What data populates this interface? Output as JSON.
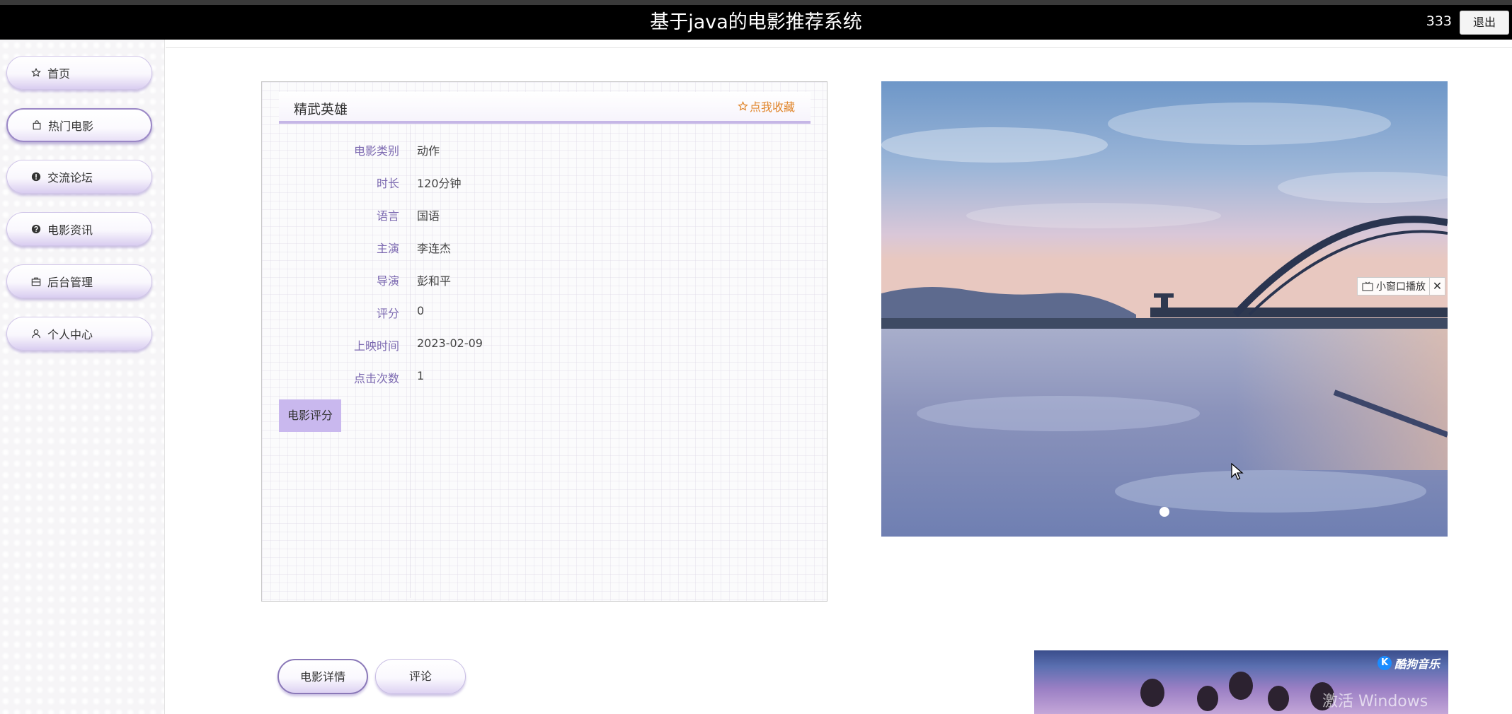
{
  "header": {
    "title": "基于java的电影推荐系统",
    "username": "333",
    "logout_label": "退出"
  },
  "sidebar": {
    "items": [
      {
        "label": "首页",
        "icon": "star-outline-icon"
      },
      {
        "label": "热门电影",
        "icon": "bag-icon",
        "active": true
      },
      {
        "label": "交流论坛",
        "icon": "exclamation-circle-icon"
      },
      {
        "label": "电影资讯",
        "icon": "question-circle-icon"
      },
      {
        "label": "后台管理",
        "icon": "briefcase-icon"
      },
      {
        "label": "个人中心",
        "icon": "user-icon"
      }
    ]
  },
  "movie": {
    "name": "精武英雄",
    "favorite_label": "点我收藏",
    "fields": [
      {
        "label": "电影类别",
        "value": "动作"
      },
      {
        "label": "时长",
        "value": "120分钟"
      },
      {
        "label": "语言",
        "value": "国语"
      },
      {
        "label": "主演",
        "value": "李连杰"
      },
      {
        "label": "导演",
        "value": "彭和平"
      },
      {
        "label": "评分",
        "value": "0"
      },
      {
        "label": "上映时间",
        "value": "2023-02-09"
      },
      {
        "label": "点击次数",
        "value": "1"
      }
    ],
    "rate_button_label": "电影评分"
  },
  "slideshow": {
    "pip_label": "小窗口播放",
    "close_symbol": "✕",
    "active_index": 1,
    "count": 1
  },
  "tabs": [
    {
      "label": "电影详情",
      "active": true
    },
    {
      "label": "评论",
      "active": false
    }
  ],
  "music_thumb": {
    "logo_letter": "K",
    "logo_text": "酷狗音乐"
  },
  "watermark": "激活 Windows",
  "colors": {
    "header_bg": "#000000",
    "accent_purple": "#c9b8ee",
    "label_purple": "#7b68b0",
    "favorite_orange": "#e0852a"
  }
}
